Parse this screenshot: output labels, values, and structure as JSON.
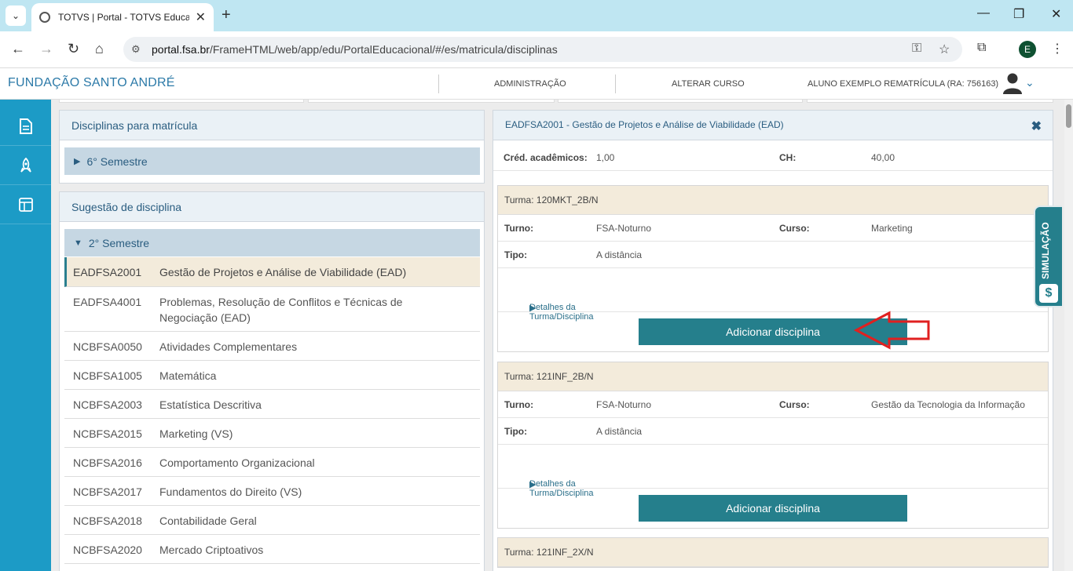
{
  "browser": {
    "tab_title": "TOTVS | Portal - TOTVS Educacional",
    "url_host": "portal.fsa.br",
    "url_path": "/FrameHTML/web/app/edu/PortalEducacional/#/es/matricula/disciplinas",
    "profile_initial": "E"
  },
  "header": {
    "brand": "FUNDAÇÃO SANTO ANDRÉ",
    "admin": "ADMINISTRAÇÃO",
    "change_course": "ALTERAR CURSO",
    "user": "ALUNO EXEMPLO REMATRÍCULA (RA: 756163)"
  },
  "left": {
    "enroll_title": "Disciplinas para matrícula",
    "enroll_semester": "6° Semestre",
    "suggest_title": "Sugestão de disciplina",
    "suggest_semester": "2° Semestre",
    "disciplines": [
      {
        "code": "EADFSA2001",
        "name": "Gestão de Projetos e Análise de Viabilidade (EAD)"
      },
      {
        "code": "EADFSA4001",
        "name": "Problemas, Resolução de Conflitos e Técnicas de Negociação (EAD)"
      },
      {
        "code": "NCBFSA0050",
        "name": "Atividades Complementares"
      },
      {
        "code": "NCBFSA1005",
        "name": "Matemática"
      },
      {
        "code": "NCBFSA2003",
        "name": "Estatística Descritiva"
      },
      {
        "code": "NCBFSA2015",
        "name": "Marketing (VS)"
      },
      {
        "code": "NCBFSA2016",
        "name": "Comportamento Organizacional"
      },
      {
        "code": "NCBFSA2017",
        "name": "Fundamentos do Direito (VS)"
      },
      {
        "code": "NCBFSA2018",
        "name": "Contabilidade Geral"
      },
      {
        "code": "NCBFSA2020",
        "name": "Mercado Criptoativos"
      }
    ]
  },
  "detail": {
    "title": "EADFSA2001 - Gestão de Projetos e Análise de Viabilidade (EAD)",
    "cred_label": "Créd. acadêmicos:",
    "cred_value": "1,00",
    "ch_label": "CH:",
    "ch_value": "40,00",
    "turno_label": "Turno:",
    "curso_label": "Curso:",
    "tipo_label": "Tipo:",
    "details_link": "Detalhes da Turma/Disciplina",
    "add_button": "Adicionar disciplina",
    "turmas": [
      {
        "title": "Turma: 120MKT_2B/N",
        "turno": "FSA-Noturno",
        "curso": "Marketing",
        "tipo": "A distância"
      },
      {
        "title": "Turma: 121INF_2B/N",
        "turno": "FSA-Noturno",
        "curso": "Gestão da Tecnologia da Informação",
        "tipo": "A distância"
      },
      {
        "title": "Turma: 121INF_2X/N"
      }
    ]
  },
  "simulation": {
    "label": "SIMULAÇÃO",
    "coin": "$"
  },
  "colors": {
    "sidebar": "#1c9bc6",
    "button": "#257f8c",
    "arrow": "#e02020"
  }
}
